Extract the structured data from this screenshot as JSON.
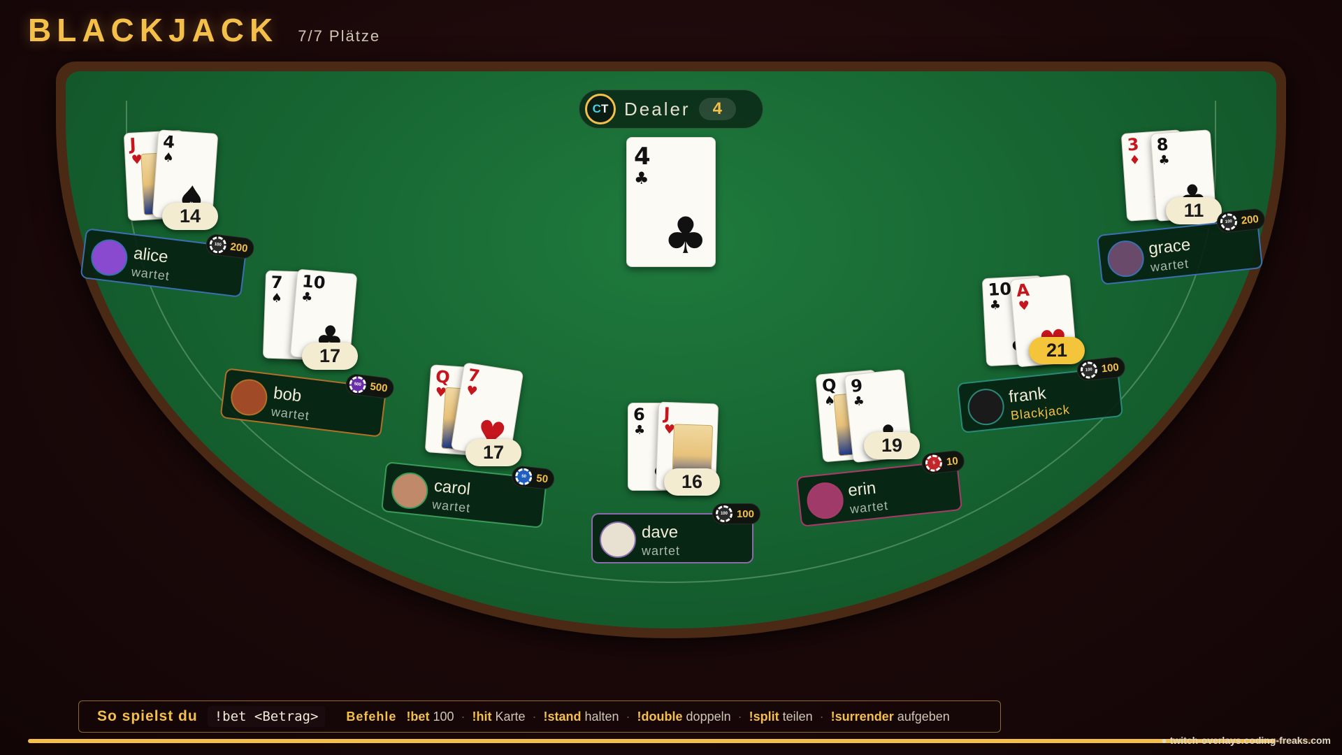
{
  "header": {
    "title": "BLACKJACK",
    "seats": "7/7 Plätze"
  },
  "dealer": {
    "logo_text": "CT",
    "label": "Dealer",
    "score": "4",
    "cards": [
      {
        "rank": "4",
        "suit": "♣",
        "color": "black"
      }
    ]
  },
  "players": [
    {
      "name": "alice",
      "status": "wartet",
      "bet": "200",
      "chip_label": "100",
      "chip_color": "#2a2a2a",
      "border_color": "#3a6fb0",
      "avatar": "unicorn-avatar",
      "score": "14",
      "cards": [
        {
          "rank": "J",
          "suit": "♥"
        },
        {
          "rank": "4",
          "suit": "♠"
        }
      ]
    },
    {
      "name": "bob",
      "status": "wartet",
      "bet": "500",
      "chip_label": "500",
      "chip_color": "#6a2da8",
      "border_color": "#b0702a",
      "avatar": "brown-circle-avatar",
      "score": "17",
      "cards": [
        {
          "rank": "7",
          "suit": "♠"
        },
        {
          "rank": "10",
          "suit": "♣"
        }
      ]
    },
    {
      "name": "carol",
      "status": "wartet",
      "bet": "50",
      "chip_label": "50",
      "chip_color": "#1f5fc0",
      "border_color": "#3a9a5a",
      "avatar": "woman-avatar",
      "score": "17",
      "cards": [
        {
          "rank": "Q",
          "suit": "♥"
        },
        {
          "rank": "7",
          "suit": "♥"
        }
      ]
    },
    {
      "name": "dave",
      "status": "wartet",
      "bet": "100",
      "chip_label": "100",
      "chip_color": "#2a2a2a",
      "border_color": "#8a6aa8",
      "avatar": "man-cartoon-avatar",
      "score": "16",
      "cards": [
        {
          "rank": "6",
          "suit": "♣"
        },
        {
          "rank": "J",
          "suit": "♥"
        }
      ]
    },
    {
      "name": "erin",
      "status": "wartet",
      "bet": "10",
      "chip_label": "5",
      "chip_color": "#c0262a",
      "border_color": "#a83a6a",
      "avatar": "pink-circle-avatar",
      "score": "19",
      "cards": [
        {
          "rank": "Q",
          "suit": "♠"
        },
        {
          "rank": "9",
          "suit": "♣"
        }
      ]
    },
    {
      "name": "frank",
      "status": "Blackjack",
      "bet": "100",
      "chip_label": "100",
      "chip_color": "#2a2a2a",
      "border_color": "#2a8a7a",
      "avatar": "raven-avatar",
      "score": "21",
      "cards": [
        {
          "rank": "10",
          "suit": "♣"
        },
        {
          "rank": "A",
          "suit": "♥"
        }
      ]
    },
    {
      "name": "grace",
      "status": "wartet",
      "bet": "200",
      "chip_label": "100",
      "chip_color": "#2a2a2a",
      "border_color": "#3a6fb0",
      "avatar": "woman-portrait-avatar",
      "score": "11",
      "cards": [
        {
          "rank": "3",
          "suit": "♦"
        },
        {
          "rank": "8",
          "suit": "♣"
        }
      ]
    }
  ],
  "help": {
    "title": "So spielst du",
    "bet_cmd": "!bet <Betrag>",
    "commands_label": "Befehle",
    "commands": [
      {
        "cmd": "!bet",
        "desc": "100"
      },
      {
        "cmd": "!hit",
        "desc": "Karte"
      },
      {
        "cmd": "!stand",
        "desc": "halten"
      },
      {
        "cmd": "!double",
        "desc": "doppeln"
      },
      {
        "cmd": "!split",
        "desc": "teilen"
      },
      {
        "cmd": "!surrender",
        "desc": "aufgeben"
      }
    ]
  },
  "progress": 0.97,
  "credit": "● twitch-overlays.coding-freaks.com"
}
